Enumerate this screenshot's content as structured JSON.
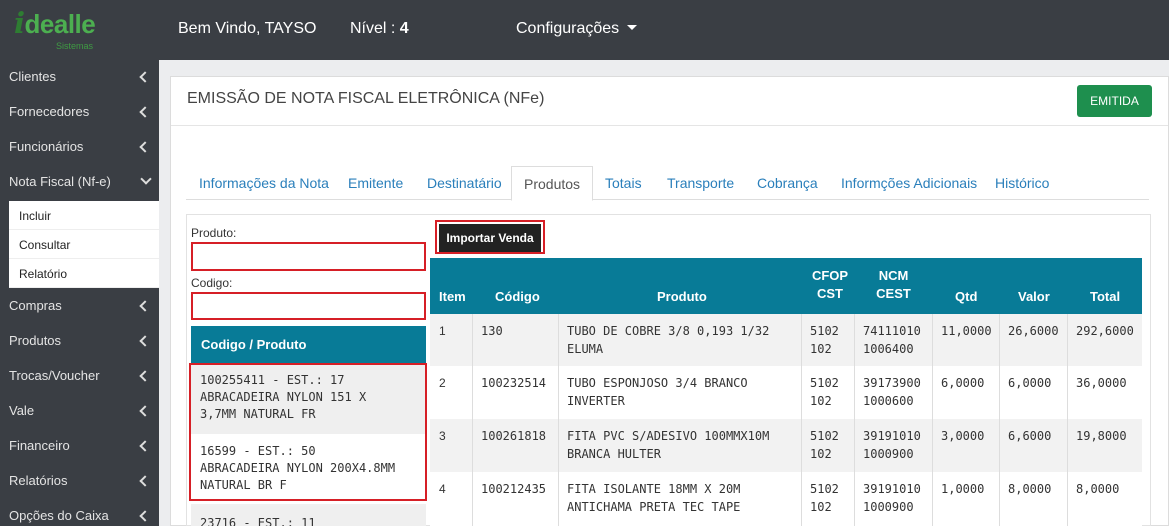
{
  "app": {
    "logo_prefix": "i",
    "logo_rest": "dealle",
    "logo_tagline": "Sistemas",
    "welcome": "Bem Vindo,  TAYSO",
    "level_label": "Nível : ",
    "level_value": "4",
    "config_menu": "Configurações"
  },
  "sidebar": {
    "items": [
      {
        "label": "Clientes"
      },
      {
        "label": "Fornecedores"
      },
      {
        "label": "Funcionários"
      },
      {
        "label": "Nota Fiscal (Nf-e)"
      },
      {
        "label": "Compras"
      },
      {
        "label": "Produtos"
      },
      {
        "label": "Trocas/Voucher"
      },
      {
        "label": "Vale"
      },
      {
        "label": "Financeiro"
      },
      {
        "label": "Relatórios"
      },
      {
        "label": "Opções do Caixa"
      }
    ],
    "subitems": [
      {
        "label": "Incluir"
      },
      {
        "label": "Consultar"
      },
      {
        "label": "Relatório"
      }
    ]
  },
  "page": {
    "title": "EMISSÃO DE NOTA FISCAL ELETRÔNICA (NFe)",
    "status_button": "EMITIDA"
  },
  "tabs": [
    {
      "label": "Informações da Nota"
    },
    {
      "label": "Emitente"
    },
    {
      "label": "Destinatário"
    },
    {
      "label": "Produtos"
    },
    {
      "label": "Totais"
    },
    {
      "label": "Transporte"
    },
    {
      "label": "Cobrança"
    },
    {
      "label": "Informções Adicionais"
    },
    {
      "label": "Histórico"
    }
  ],
  "search": {
    "produto_label": "Produto:",
    "produto_value": "",
    "codigo_label": "Codigo:",
    "codigo_value": ""
  },
  "product_list": {
    "header": "Codigo / Produto",
    "items": [
      {
        "line1": "100255411 - EST.: 17",
        "line2": "ABRACADEIRA NYLON 151 X",
        "line3": "3,7MM NATURAL FR"
      },
      {
        "line1": "16599 - EST.: 50",
        "line2": "ABRACADEIRA NYLON 200X4.8MM",
        "line3": "NATURAL BR F"
      },
      {
        "line1": "23716 - EST.: 11",
        "line2": "",
        "line3": ""
      }
    ]
  },
  "import_button": "Importar Venda",
  "table": {
    "headers": {
      "item": "Item",
      "codigo": "Código",
      "produto": "Produto",
      "cfop_1": "CFOP",
      "cfop_2": "CST",
      "ncm_1": "NCM",
      "ncm_2": "CEST",
      "qtd": "Qtd",
      "valor": "Valor",
      "total": "Total"
    },
    "rows": [
      {
        "item": "1",
        "codigo": "130",
        "produto_1": "TUBO DE COBRE 3/8 0,193 1/32",
        "produto_2": "ELUMA",
        "cfop": "5102",
        "cst": "102",
        "ncm": "74111010",
        "cest": "1006400",
        "qtd": "11,0000",
        "valor": "26,6000",
        "total": "292,6000"
      },
      {
        "item": "2",
        "codigo": "100232514",
        "produto_1": "TUBO ESPONJOSO 3/4 BRANCO",
        "produto_2": "INVERTER",
        "cfop": "5102",
        "cst": "102",
        "ncm": "39173900",
        "cest": "1000600",
        "qtd": "6,0000",
        "valor": "6,0000",
        "total": "36,0000"
      },
      {
        "item": "3",
        "codigo": "100261818",
        "produto_1": "FITA PVC S/ADESIVO 100MMX10M",
        "produto_2": "BRANCA HULTER",
        "cfop": "5102",
        "cst": "102",
        "ncm": "39191010",
        "cest": "1000900",
        "qtd": "3,0000",
        "valor": "6,6000",
        "total": "19,8000"
      },
      {
        "item": "4",
        "codigo": "100212435",
        "produto_1": "FITA ISOLANTE 18MM X 20M",
        "produto_2": "ANTICHAMA PRETA TEC TAPE",
        "cfop": "5102",
        "cst": "102",
        "ncm": "39191010",
        "cest": "1000900",
        "qtd": "1,0000",
        "valor": "8,0000",
        "total": "8,0000"
      }
    ]
  }
}
